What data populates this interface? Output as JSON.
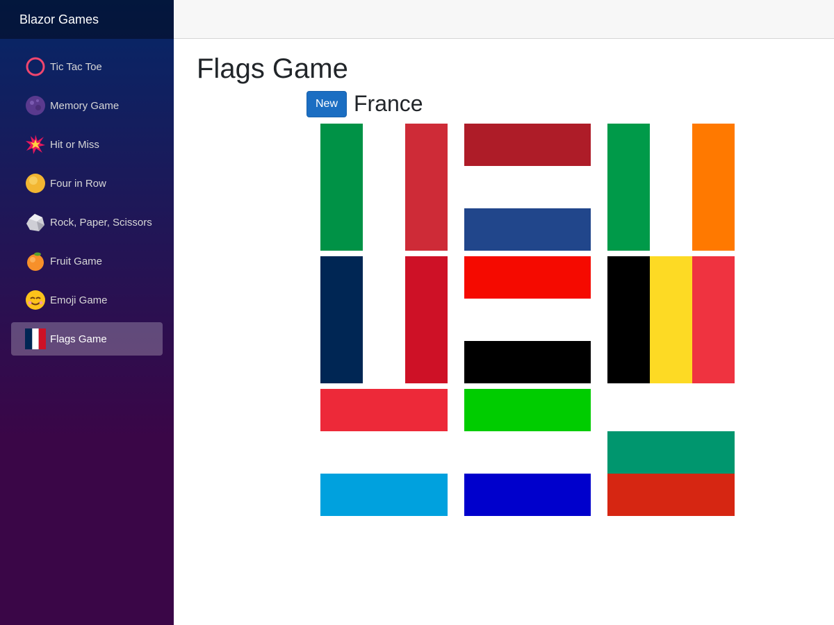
{
  "app": {
    "brand": "Blazor Games"
  },
  "sidebar": {
    "items": [
      {
        "label": "Tic Tac Toe",
        "icon": "ring-icon"
      },
      {
        "label": "Memory Game",
        "icon": "moon-icon"
      },
      {
        "label": "Hit or Miss",
        "icon": "explosion-icon"
      },
      {
        "label": "Four in Row",
        "icon": "yellow-disc-icon"
      },
      {
        "label": "Rock, Paper, Scissors",
        "icon": "rock-icon"
      },
      {
        "label": "Fruit Game",
        "icon": "tangerine-icon"
      },
      {
        "label": "Emoji Game",
        "icon": "smiling-face-icon"
      },
      {
        "label": "Flags Game",
        "icon": "france-flag-icon",
        "active": true
      }
    ]
  },
  "main": {
    "title": "Flags Game",
    "new_button": "New",
    "target_country": "France"
  },
  "flags": [
    {
      "orientation": "vertical",
      "colors": [
        "#009246",
        "#ffffff",
        "#ce2b37"
      ]
    },
    {
      "orientation": "horizontal",
      "colors": [
        "#ae1c28",
        "#ffffff",
        "#21468b"
      ]
    },
    {
      "orientation": "vertical",
      "colors": [
        "#009a49",
        "#ffffff",
        "#ff7900"
      ]
    },
    {
      "orientation": "vertical",
      "colors": [
        "#002654",
        "#ffffff",
        "#ce1126"
      ]
    },
    {
      "orientation": "horizontal",
      "colors": [
        "#f50a00",
        "#ffffff",
        "#000000"
      ]
    },
    {
      "orientation": "vertical",
      "colors": [
        "#000000",
        "#fdda24",
        "#ef3340"
      ]
    },
    {
      "orientation": "horizontal",
      "colors": [
        "#ed2939",
        "#ffffff",
        "#00a1de"
      ]
    },
    {
      "orientation": "horizontal",
      "colors": [
        "#00cc00",
        "#ffffff",
        "#0000cc"
      ]
    },
    {
      "orientation": "horizontal",
      "colors": [
        "#ffffff",
        "#00966e",
        "#d62612"
      ]
    }
  ]
}
